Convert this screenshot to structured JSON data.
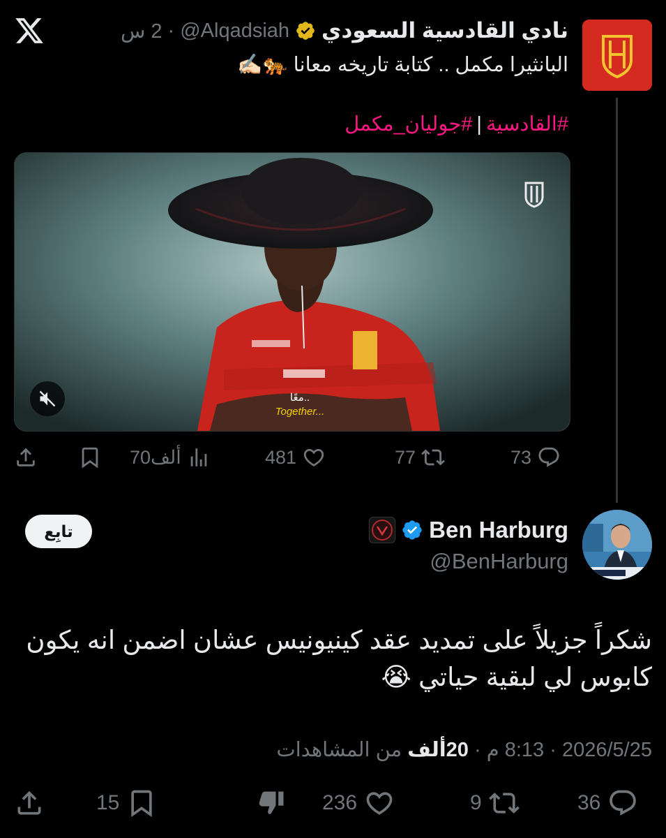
{
  "colors": {
    "background": "#000000",
    "text": "#e7e9ea",
    "muted": "#71767b",
    "hashtag": "#f91880",
    "club_red": "#d42a1f",
    "verified_blue": "#1d9bf0",
    "verified_gold": "#e2b719"
  },
  "app": {
    "logo_icon": "x-logo-icon"
  },
  "tweet1": {
    "author_name": "نادي القادسية السعودي",
    "handle": "@Alqadsiah",
    "separator": "·",
    "time": "2 س",
    "text": "البانثيرا مكمل .. كتابة تاريخه معانا 🐅✍🏻",
    "hashtag1": "#القادسية",
    "hashtag_separator": "|",
    "hashtag2": "#جوليان_مكمل",
    "media": {
      "subtitle_ar": "معًا..",
      "subtitle_en": "Together..."
    },
    "actions": {
      "replies": "73",
      "retweets": "77",
      "likes": "481",
      "views": "70ألف"
    }
  },
  "tweet2": {
    "author_name": "Ben Harburg",
    "handle": "@BenHarburg",
    "follow_label": "تابِع",
    "text": "شكراً جزيلاً على تمديد عقد كينيونيس عشان اضمن انه يكون كابوس لي لبقية حياتي 😭",
    "date": "2026/5/25",
    "dot": "·",
    "time": "8:13 م",
    "views_count": "20ألف",
    "views_label": "من المشاهدات",
    "actions": {
      "replies": "36",
      "retweets": "9",
      "likes": "236",
      "bookmarks": "15"
    }
  }
}
